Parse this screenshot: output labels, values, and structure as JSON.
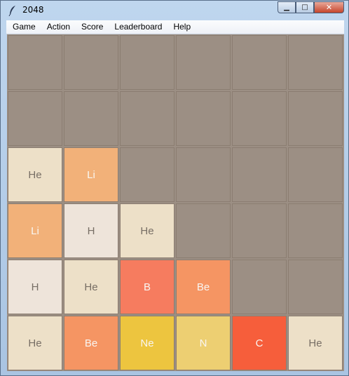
{
  "window": {
    "title": "2048"
  },
  "caption_buttons": {
    "minimize": "▁",
    "maximize": "□",
    "close": "✕"
  },
  "menu": [
    "Game",
    "Action",
    "Score",
    "Leaderboard",
    "Help"
  ],
  "colors": {
    "empty": "#9c8f84",
    "He": "#ede0c8",
    "H": "#eee4da",
    "Li": "#f2b179",
    "Be": "#f59563",
    "B": "#f67c5f",
    "C": "#f65e3b",
    "N": "#edcf72",
    "Ne": "#edc53f",
    "dark_text": "#776e65",
    "light_text": "#f9f6f2"
  },
  "board": [
    [
      "",
      "",
      "",
      "",
      "",
      ""
    ],
    [
      "",
      "",
      "",
      "",
      "",
      ""
    ],
    [
      "He",
      "Li",
      "",
      "",
      "",
      ""
    ],
    [
      "Li",
      "H",
      "He",
      "",
      "",
      ""
    ],
    [
      "H",
      "He",
      "B",
      "Be",
      "",
      ""
    ],
    [
      "He",
      "Be",
      "Ne",
      "N",
      "C",
      "He"
    ]
  ]
}
